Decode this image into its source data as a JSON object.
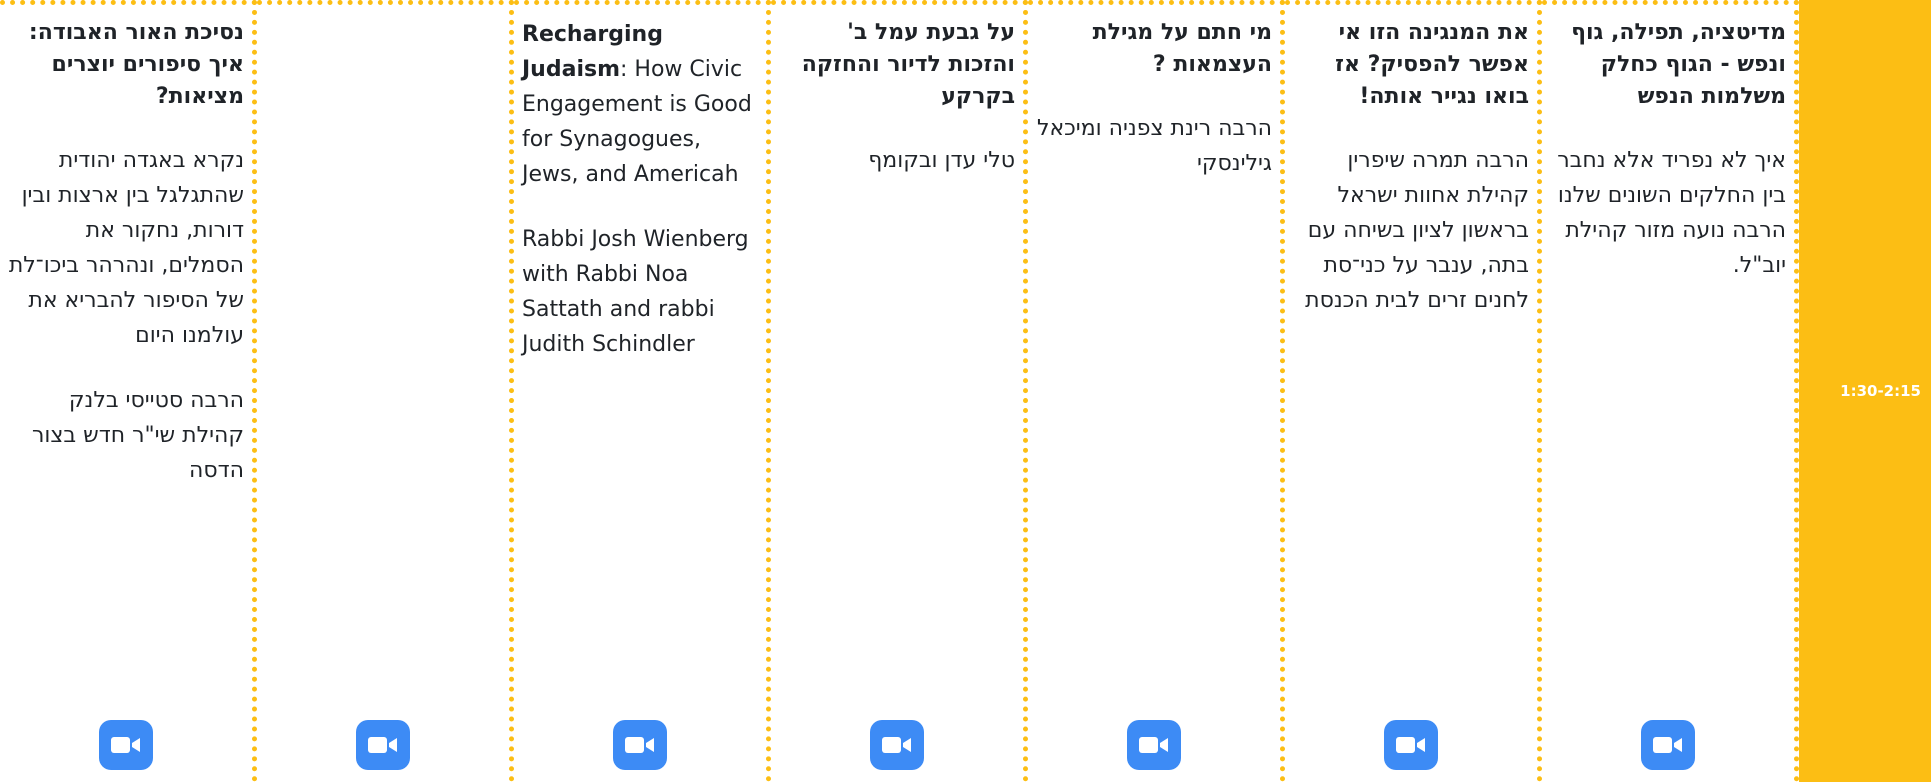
{
  "time_slot": "1:30-2:15",
  "sessions": [
    {
      "title": "מדיטציה, תפילה, גוף ונפש - הגוף כחלק משלמות הנפש",
      "desc": "איך לא נפריד אלא נחבר בין החלקים השונים שלנו",
      "speaker": "הרבה נועה מזור קהילת יוב\"ל."
    },
    {
      "title": "את המנגינה הזו אי אפשר להפסיק? אז בואו נגייר אותה!",
      "desc": "",
      "speaker": "הרבה תמרה שיפרין קהילת אחוות ישראל בראשון לציון בשיחה עם בתה, ענבר על כני־סת לחנים זרים לבית הכנסת"
    },
    {
      "title": "מי חתם על מגילת העצמאות ?",
      "desc": "",
      "speaker": "הרבה רינת צפניה ומיכאל גילינסקי"
    },
    {
      "title": "על גבעת עמל ב' והזכות לדיור והחזקה בקרקע",
      "desc": "",
      "speaker": "טלי עדן ובקומף"
    },
    {
      "title_bold": "Recharging Judaism",
      "title_rest": ": How Civic Engagement is Good for Synagogues, Jews, and Americah",
      "speaker": "Rabbi Josh Wienberg with Rabbi Noa Sattath and  rabbi Judith Schindler"
    },
    {
      "title": "",
      "desc": "",
      "speaker": ""
    },
    {
      "title": "נסיכת האור האבודה: איך סיפורים יוצרים מציאות?",
      "desc": "נקרא באגדה יהודית שהתגלגל בין ארצות ובין דורות, נחקור את הסמלים, ונהרהר ביכו־לת של הסיפור להבריא את עולמנו היום",
      "speaker": "הרבה סטייסי בלנק קהילת שי\"ר חדש בצור הדסה"
    }
  ],
  "icons": {
    "join": "zoom-video-icon"
  },
  "colors": {
    "accent": "#fcbe14",
    "zoom": "#3d8bf5",
    "time_text": "#ffffff"
  }
}
